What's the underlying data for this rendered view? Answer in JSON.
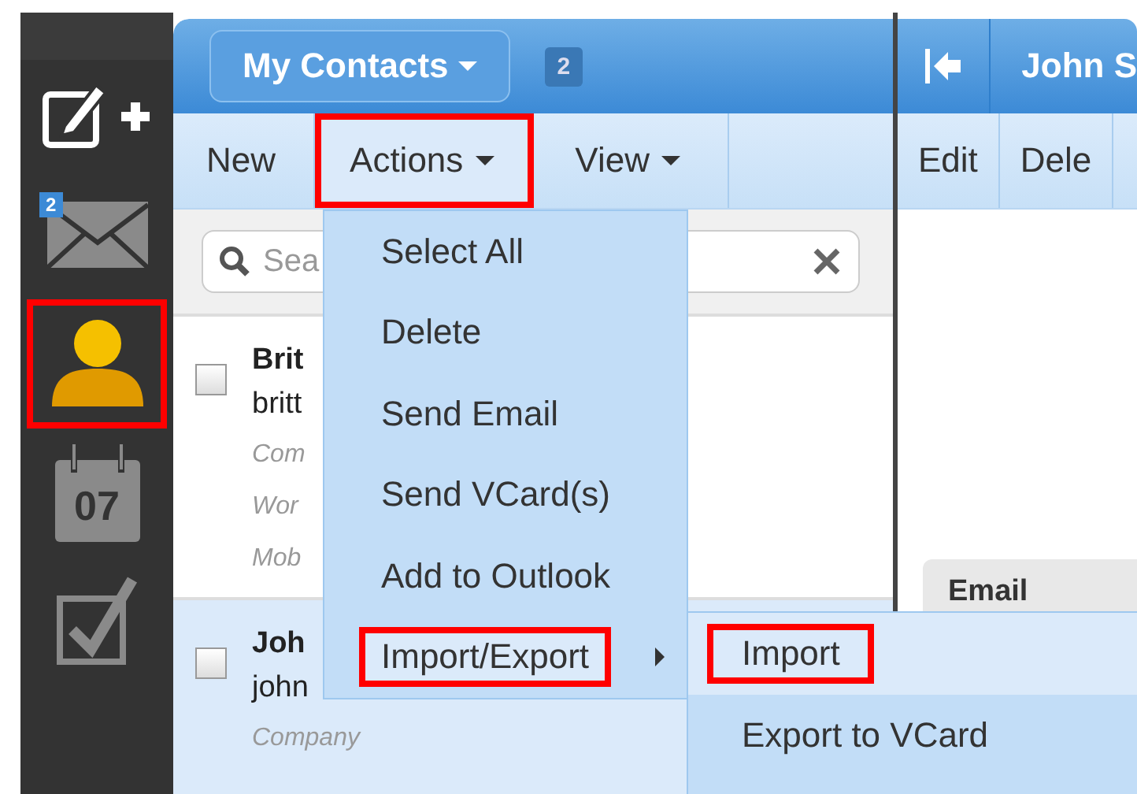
{
  "sidebar": {
    "items": [
      {
        "kind": "compose",
        "selected": false,
        "highlighted": false
      },
      {
        "kind": "mail",
        "badge": "2",
        "selected": false,
        "highlighted": false
      },
      {
        "kind": "contacts",
        "selected": true,
        "highlighted": true
      },
      {
        "kind": "calendar",
        "day": "07",
        "selected": false,
        "highlighted": false
      },
      {
        "kind": "tasks",
        "selected": false,
        "highlighted": false
      }
    ]
  },
  "folder": {
    "label": "My Contacts",
    "count": "2"
  },
  "toolbar": [
    {
      "label": "New",
      "dropdown": false,
      "highlighted": false,
      "expanded": false
    },
    {
      "label": "Actions",
      "dropdown": true,
      "highlighted": true,
      "expanded": true
    },
    {
      "label": "View",
      "dropdown": true,
      "highlighted": false,
      "expanded": false
    }
  ],
  "search": {
    "placeholder": "Sea"
  },
  "contacts": [
    {
      "name": "Brit",
      "email": "britt",
      "fields": [
        "Com",
        "Wor",
        "Mob"
      ],
      "checked": false,
      "selected": false
    },
    {
      "name": "Joh",
      "email": "john",
      "fields": [
        "Company"
      ],
      "checked": false,
      "selected": true
    }
  ],
  "actions_menu": {
    "items": [
      {
        "label": "Select All",
        "submenu": false,
        "selected": false,
        "highlighted": false
      },
      {
        "label": "Delete",
        "submenu": false,
        "selected": false,
        "highlighted": false
      },
      {
        "label": "Send Email",
        "submenu": false,
        "selected": false,
        "highlighted": false
      },
      {
        "label": "Send VCard(s)",
        "submenu": false,
        "selected": false,
        "highlighted": false
      },
      {
        "label": "Add to Outlook",
        "submenu": false,
        "selected": false,
        "highlighted": false
      },
      {
        "label": "Import/Export",
        "submenu": true,
        "selected": true,
        "highlighted": true
      }
    ]
  },
  "submenu": {
    "items": [
      {
        "label": "Import",
        "selected": true,
        "highlighted": true
      },
      {
        "label": "Export to VCard",
        "selected": false,
        "highlighted": false
      }
    ]
  },
  "detail": {
    "title": "John S",
    "toolbar": [
      "Edit",
      "Dele"
    ],
    "section": "Email"
  }
}
